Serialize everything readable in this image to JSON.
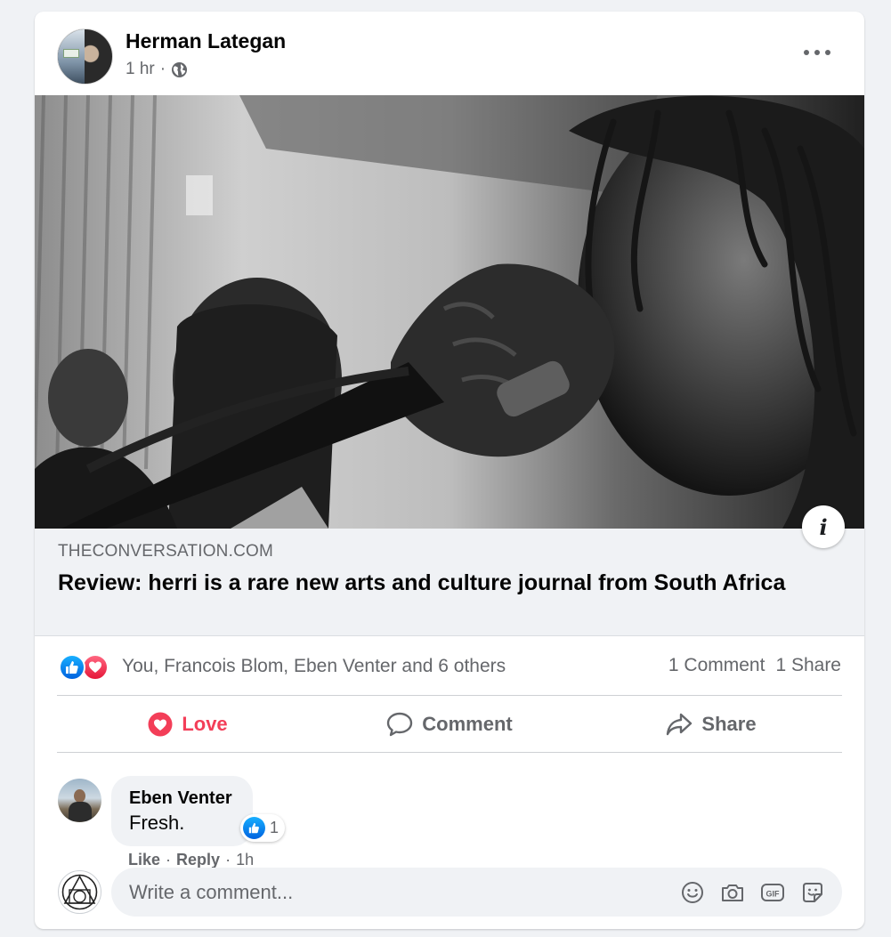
{
  "post": {
    "author": "Herman Lategan",
    "time": "1 hr",
    "separator": "·"
  },
  "link": {
    "domain": "THECONVERSATION.COM",
    "title": "Review: herri is a rare new arts and culture journal from South Africa"
  },
  "reactions": {
    "names": "You, Francois Blom, Eben Venter and 6 others",
    "comments": "1 Comment",
    "shares": "1 Share",
    "types": [
      "like-icon",
      "love-icon"
    ]
  },
  "actions": {
    "love": "Love",
    "comment": "Comment",
    "share": "Share"
  },
  "comment": {
    "author": "Eben Venter",
    "text": "Fresh.",
    "reaction_count": "1",
    "like": "Like",
    "reply": "Reply",
    "time": "1h",
    "separator": "·"
  },
  "composer": {
    "placeholder": "Write a comment..."
  },
  "colors": {
    "love": "#f33e58",
    "like_blue": "#1877f2",
    "secondary_text": "#65676b",
    "background": "#f0f2f5"
  }
}
